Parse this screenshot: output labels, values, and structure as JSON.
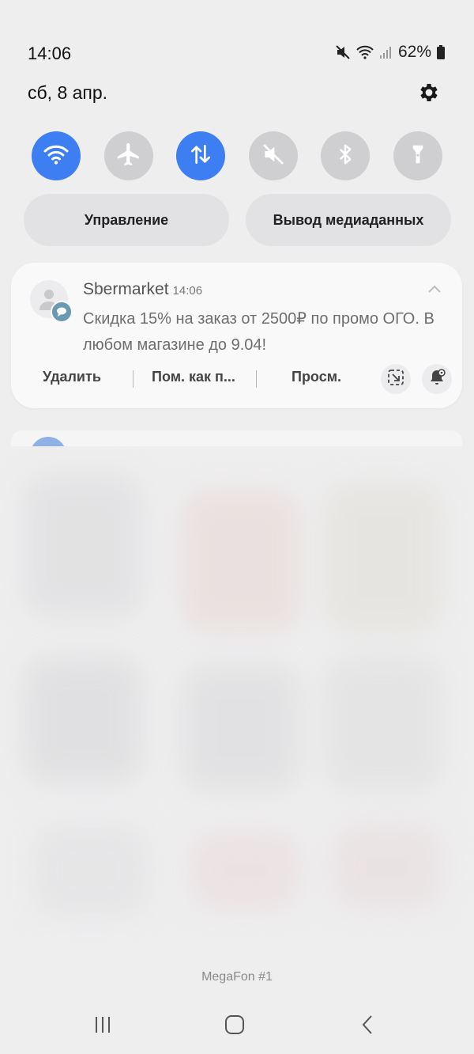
{
  "status_bar": {
    "time": "14:06",
    "battery_percent": "62%",
    "icons": [
      "mute-icon",
      "wifi-icon",
      "signal-icon",
      "battery-icon"
    ]
  },
  "header": {
    "date": "сб, 8 апр."
  },
  "quick_toggles": [
    {
      "name": "wifi",
      "on": true
    },
    {
      "name": "airplane-mode",
      "on": false
    },
    {
      "name": "mobile-data",
      "on": true
    },
    {
      "name": "sound-mute",
      "on": false
    },
    {
      "name": "bluetooth",
      "on": false
    },
    {
      "name": "flashlight",
      "on": false
    }
  ],
  "panel_buttons": {
    "control": "Управление",
    "media_output": "Вывод медиаданных"
  },
  "notification": {
    "app_name": "Sbermarket",
    "time": "14:06",
    "text": "Скидка 15% на заказ от 2500₽ по промо ОГО. В любом магазине до 9.04!",
    "actions": {
      "delete": "Удалить",
      "mark_as": "Пом. как п...",
      "view": "Просм."
    }
  },
  "footer": {
    "carrier": "MegaFon #1"
  },
  "colors": {
    "accent": "#3d7ef3",
    "toggle_off": "#cfcfd1",
    "background": "#eeeeef"
  }
}
